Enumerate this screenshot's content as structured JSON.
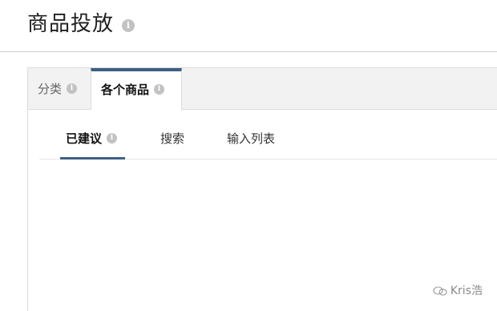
{
  "header": {
    "title": "商品投放",
    "info_icon": "info-icon"
  },
  "tabs": {
    "category_label": "分类",
    "items_label": "各个商品",
    "active": "各个商品"
  },
  "subtabs": {
    "suggested_label": "已建议",
    "search_label": "搜索",
    "list_label": "输入列表",
    "active": "已建议"
  },
  "watermark": {
    "text": "Kris浩",
    "icon": "wechat-icon"
  },
  "colors": {
    "accent": "#3e5f84",
    "info_icon": "#c2c2c2"
  }
}
